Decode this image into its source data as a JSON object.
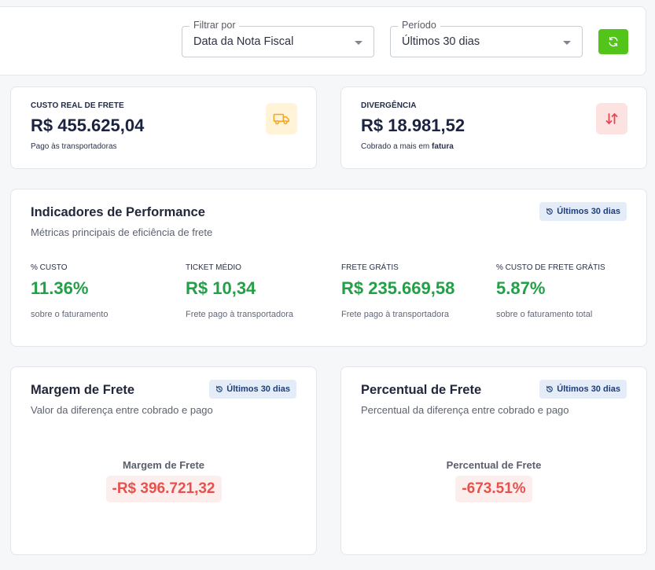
{
  "filters": {
    "filter_by": {
      "label": "Filtrar por",
      "value": "Data da Nota Fiscal"
    },
    "period": {
      "label": "Período",
      "value": "Últimos 30 dias"
    },
    "refresh_icon": "refresh-icon",
    "refresh_color": "#52c41a"
  },
  "kpis": {
    "custo": {
      "label": "CUSTO REAL DE FRETE",
      "value": "R$ 455.625,04",
      "sub": "Pago às transportadoras",
      "icon": "truck-icon",
      "icon_color": "#f4a62a",
      "icon_bg": "#fff4d8"
    },
    "divergencia": {
      "label": "DIVERGÊNCIA",
      "value": "R$ 18.981,52",
      "sub_prefix": "Cobrado a mais em",
      "sub_emphasis": "fatura",
      "icon": "arrows-up-down-icon",
      "icon_color": "#e5484d",
      "icon_bg": "#fde2e2"
    }
  },
  "performance": {
    "title": "Indicadores de Performance",
    "subtitle": "Métricas principais de eficiência de frete",
    "badge": "Últimos 30 dias",
    "metrics": [
      {
        "label": "% CUSTO",
        "value": "11.36%",
        "sub": "sobre o faturamento"
      },
      {
        "label": "TICKET MÉDIO",
        "value": "R$ 10,34",
        "sub": "Frete pago à transportadora"
      },
      {
        "label": "FRETE GRÁTIS",
        "value": "R$ 235.669,58",
        "sub": "Frete pago à transportadora"
      },
      {
        "label": "% CUSTO DE FRETE GRÁTIS",
        "value": "5.87%",
        "sub": "sobre o faturamento total"
      }
    ],
    "value_color": "#23a047"
  },
  "margem": {
    "title": "Margem de Frete",
    "subtitle": "Valor da diferença entre cobrado e pago",
    "badge": "Últimos 30 dias",
    "label": "Margem de Frete",
    "value": "-R$ 396.721,32"
  },
  "percentual": {
    "title": "Percentual de Frete",
    "subtitle": "Percentual da diferença entre cobrado e pago",
    "badge": "Últimos 30 dias",
    "label": "Percentual de Frete",
    "value": "-673.51%"
  },
  "colors": {
    "negative": "#e8514b",
    "negative_bg": "#fdeeee",
    "badge_bg": "#e3ecf7",
    "badge_text": "#1f3d7a"
  }
}
